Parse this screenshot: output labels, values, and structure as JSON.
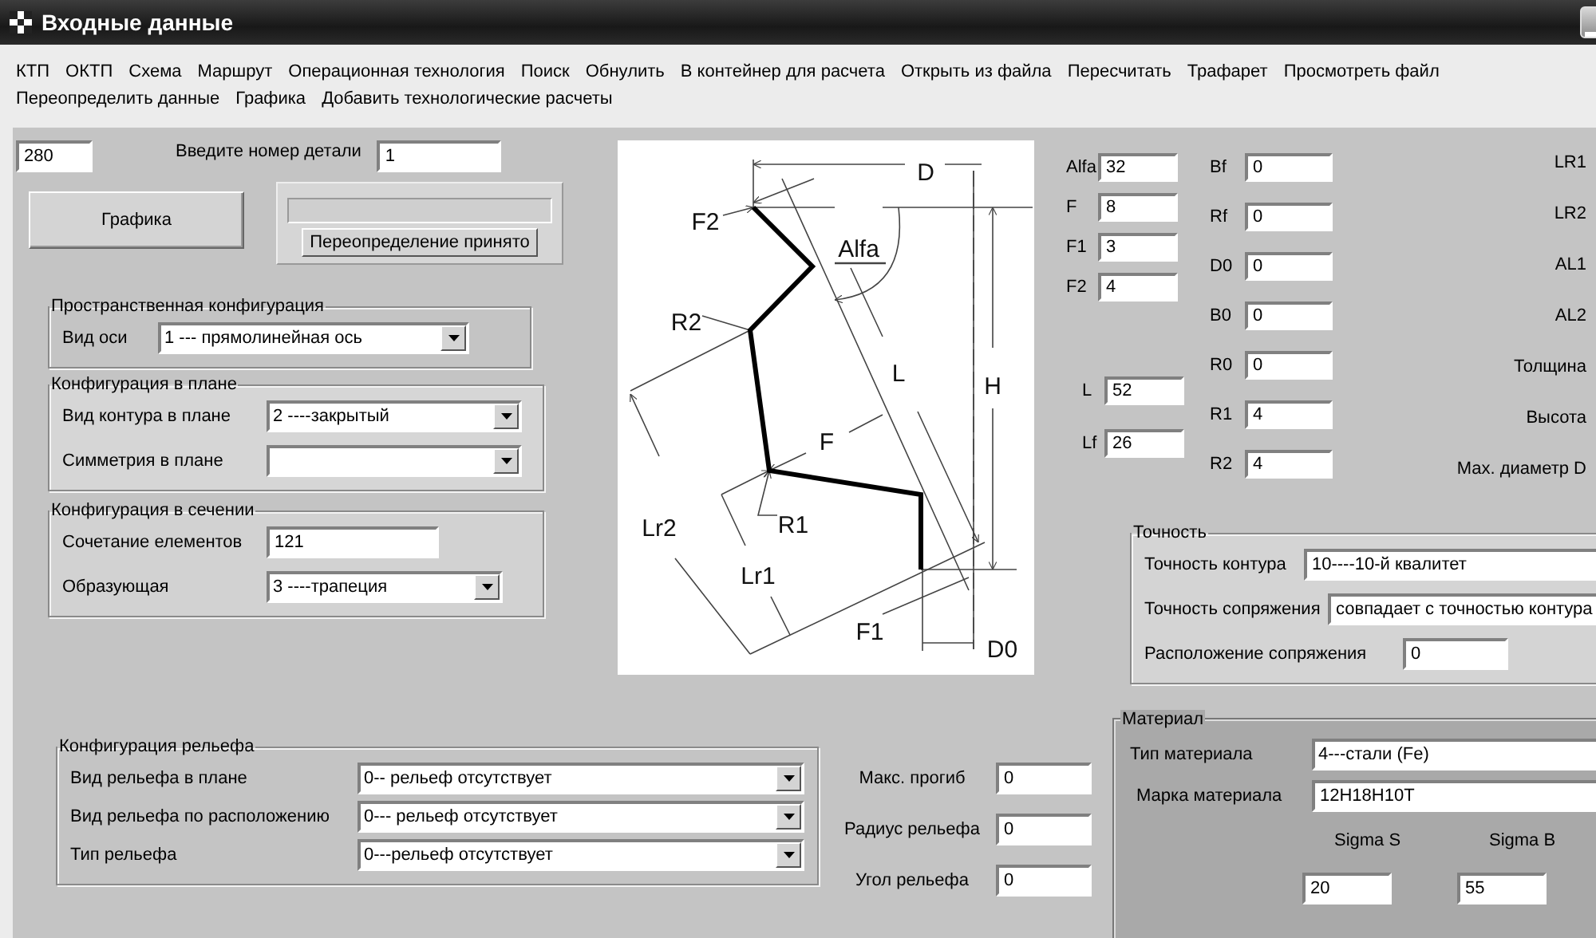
{
  "window": {
    "title": "Входные данные"
  },
  "menu_rows": [
    [
      "КТП",
      "ОКТП",
      "Схема",
      "Маршрут",
      "Операционная технология",
      "Поиск",
      "Обнулить",
      "В контейнер для расчета",
      "Открыть из файла",
      "Пересчитать",
      "Трафарет",
      "Просмотреть файл"
    ],
    [
      "Переопределить данные",
      "Графика",
      "Добавить технологические расчеты"
    ]
  ],
  "top": {
    "number": "280",
    "part_label": "Введите номер детали",
    "part_number": "1",
    "graphics_button": "Графика",
    "accept_button": "Переопределение принято"
  },
  "spatial": {
    "title": "Пространственная конфигурация",
    "rows": [
      {
        "label": "Вид оси",
        "value": "1 --- прямолинейная ось",
        "kind": "combo"
      }
    ]
  },
  "plan": {
    "title": "Конфигурация в плане",
    "rows": [
      {
        "label": "Вид контура в плане",
        "value": "2 ----закрытый",
        "kind": "combo"
      },
      {
        "label": "Симметрия в плане",
        "kind": "combo"
      }
    ]
  },
  "section": {
    "title": "Конфигурация в сечении",
    "rows": [
      {
        "label": "Сочетание елементов",
        "value": "121",
        "kind": "field"
      },
      {
        "label": "Образующая",
        "value": "3 ----трапеция",
        "kind": "combo"
      }
    ]
  },
  "drawing_labels": [
    "D",
    "F2",
    "Alfa",
    "R2",
    "L",
    "H",
    "F",
    "R1",
    "Lr2",
    "Lr1",
    "F1",
    "D0"
  ],
  "params_left": [
    {
      "label": "Alfa",
      "value": "32"
    },
    {
      "label": "F",
      "value": "8"
    },
    {
      "label": "F1",
      "value": "3"
    },
    {
      "label": "F2",
      "value": "4"
    },
    {
      "label": "L",
      "value": "52"
    },
    {
      "label": "Lf",
      "value": "26"
    }
  ],
  "params_mid": [
    {
      "label": "Bf",
      "value": "0"
    },
    {
      "label": "Rf",
      "value": "0"
    },
    {
      "label": "D0",
      "value": "0"
    },
    {
      "label": "B0",
      "value": "0"
    },
    {
      "label": "R0",
      "value": "0"
    },
    {
      "label": "R1",
      "value": "4"
    },
    {
      "label": "R2",
      "value": "4"
    }
  ],
  "params_right": [
    "LR1",
    "LR2",
    "AL1",
    "AL2",
    "Толщина",
    "Высота",
    "Мах. диаметр D"
  ],
  "accuracy": {
    "title": "Точность",
    "rows": [
      {
        "label": "Точность контура",
        "value": "10----10-й квалитет"
      },
      {
        "label": "Точность сопряжения",
        "value": "совпадает с точностью контура"
      },
      {
        "label": "Расположение сопряжения",
        "value": "0"
      }
    ]
  },
  "relief": {
    "title": "Конфигурация  рельефа",
    "rows": [
      {
        "label": "Вид рельефа в плане",
        "value": "0-- рельеф отсутствует",
        "kind": "combo"
      },
      {
        "label": "Вид рельефа по расположению",
        "value": "0--- рельеф отсутствует",
        "kind": "combo"
      },
      {
        "label": "Тип рельефа",
        "value": "0---рельеф отсутствует",
        "kind": "combo"
      }
    ]
  },
  "relief_params": [
    {
      "label": "Макс. прогиб",
      "value": "0"
    },
    {
      "label": "Радиус рельефа",
      "value": "0"
    },
    {
      "label": "Угол рельефа",
      "value": "0"
    }
  ],
  "material": {
    "title": "Материал",
    "type_label": "Тип материала",
    "type_value": "4---стали (Fe)",
    "grade_label": "Марка материала",
    "grade_value": "12H18H10T",
    "sigma": [
      {
        "label": "Sigma S",
        "value": "20"
      },
      {
        "label": "Sigma B",
        "value": "55"
      }
    ]
  }
}
